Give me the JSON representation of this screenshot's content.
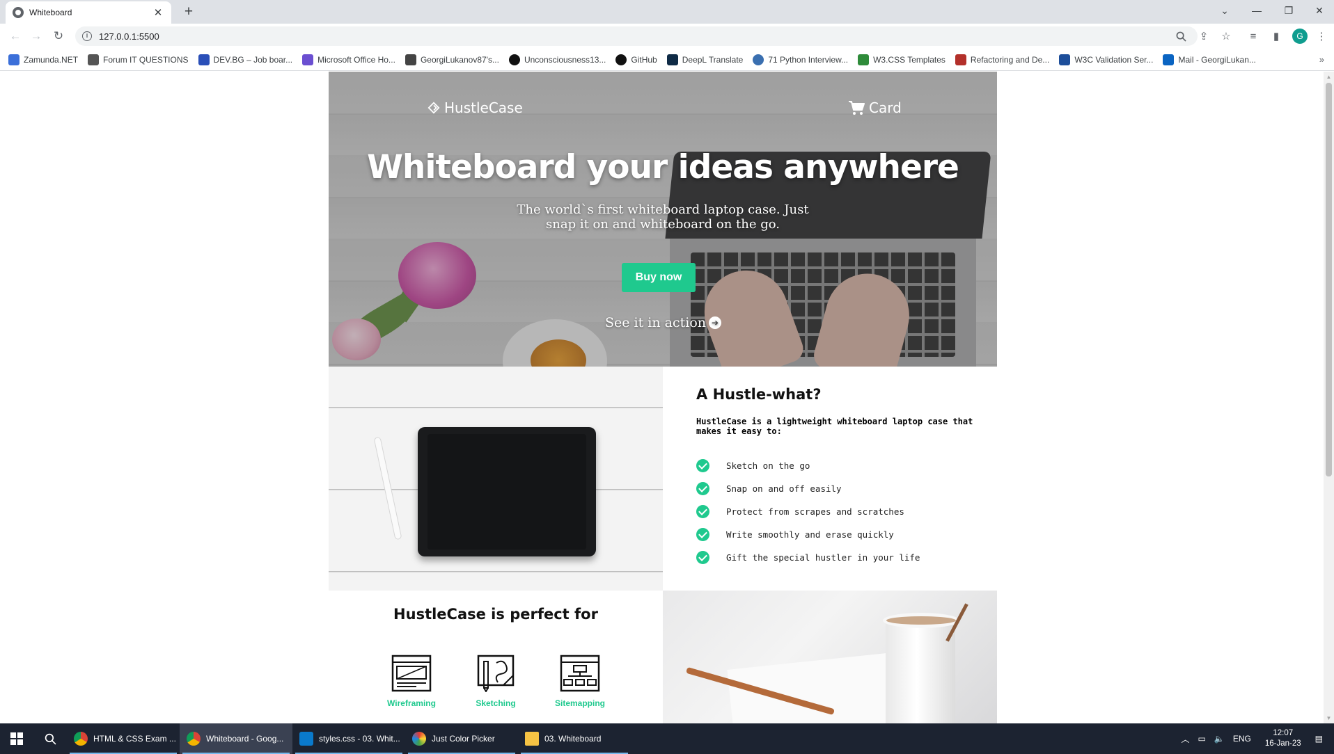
{
  "browser": {
    "tab_title": "Whiteboard",
    "url": "127.0.0.1:5500",
    "profile_initial": "G",
    "bookmarks": [
      {
        "label": "Zamunda.NET",
        "color": "#3b6fd9"
      },
      {
        "label": "Forum IT QUESTIONS",
        "color": "#555555"
      },
      {
        "label": "DEV.BG – Job boar...",
        "color": "#2a4fb8"
      },
      {
        "label": "Microsoft Office Ho...",
        "color": "#6b4fd1"
      },
      {
        "label": "GeorgiLukanov87's...",
        "color": "#444444"
      },
      {
        "label": "Unconsciousness13...",
        "color": "#111111"
      },
      {
        "label": "GitHub",
        "color": "#111111"
      },
      {
        "label": "DeepL Translate",
        "color": "#0f2b46"
      },
      {
        "label": "71 Python Interview...",
        "color": "#3a6fb0"
      },
      {
        "label": "W3.CSS Templates",
        "color": "#2e8b3a"
      },
      {
        "label": "Refactoring and De...",
        "color": "#b3302a"
      },
      {
        "label": "W3C Validation Ser...",
        "color": "#1d4e9a"
      },
      {
        "label": "Mail - GeorgiLukan...",
        "color": "#0a64c2"
      }
    ]
  },
  "hero": {
    "logo": "HustleCase",
    "cart": "Card",
    "title": "Whiteboard your ideas anywhere",
    "subtitle": "The world`s first whiteboard laptop case. Just snap it on and whiteboard on the go.",
    "buy_label": "Buy now",
    "see_action": "See it in action"
  },
  "about": {
    "heading": "A Hustle-what?",
    "lead": "HustleCase is a lightweight whiteboard laptop case that makes it easy to:",
    "items": [
      "Sketch on the go",
      "Snap on and off easily",
      "Protect from scrapes and scratches",
      "Write smoothly and erase quickly",
      "Gift the special hustler in your life"
    ]
  },
  "perfect": {
    "heading": "HustleCase is perfect for",
    "features": [
      "Wireframing",
      "Sketching",
      "Sitemapping"
    ]
  },
  "colors": {
    "accent": "#1fc98e"
  },
  "taskbar": {
    "apps": [
      "HTML & CSS Exam ...",
      "Whiteboard - Goog...",
      "styles.css - 03. Whit...",
      "Just Color Picker",
      "03. Whiteboard"
    ],
    "language": "ENG",
    "time": "12:07",
    "date": "16-Jan-23"
  }
}
